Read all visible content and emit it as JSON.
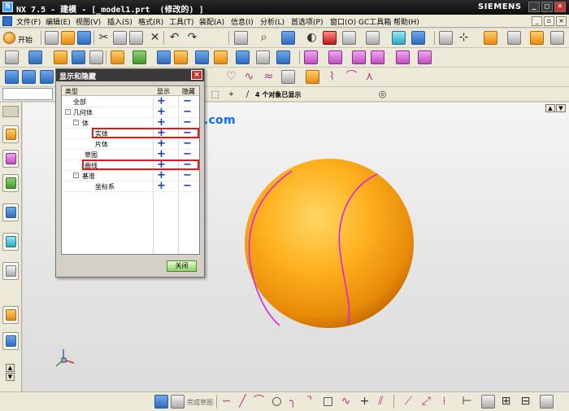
{
  "window": {
    "title": "NX 7.5 - 建模 - [_model1.prt  (修改的) ]",
    "brand": "SIEMENS",
    "controls": [
      "_",
      "□",
      "×"
    ]
  },
  "menu": {
    "items": [
      "文件(F)",
      "编辑(E)",
      "视图(V)",
      "插入(S)",
      "格式(R)",
      "工具(T)",
      "装配(A)",
      "信息(I)",
      "分析(L)",
      "首选项(P)",
      "窗口(O)",
      "GC工具箱",
      "帮助(H)"
    ]
  },
  "toolbar": {
    "start_label": "开始"
  },
  "selection_bar": {
    "status": "4 个对象已显示"
  },
  "watermark": "www.rjzxw.com",
  "dialog": {
    "title": "显示和隐藏",
    "close_glyph": "×",
    "columns": {
      "type": "类型",
      "show": "显示",
      "hide": "隐藏"
    },
    "rows": [
      {
        "label": "全部",
        "level": 0,
        "expander": "",
        "highlighted": false
      },
      {
        "label": "几何体",
        "level": 0,
        "expander": "-",
        "highlighted": false
      },
      {
        "label": "体",
        "level": 1,
        "expander": "-",
        "highlighted": false
      },
      {
        "label": "实体",
        "level": 2,
        "expander": "",
        "highlighted": true
      },
      {
        "label": "片体",
        "level": 2,
        "expander": "",
        "highlighted": false
      },
      {
        "label": "草图",
        "level": 1,
        "expander": "",
        "highlighted": false
      },
      {
        "label": "曲线",
        "level": 1,
        "expander": "",
        "highlighted": true
      },
      {
        "label": "基准",
        "level": 1,
        "expander": "-",
        "highlighted": false
      },
      {
        "label": "坐标系",
        "level": 2,
        "expander": "",
        "highlighted": false
      }
    ],
    "show_glyph": "+",
    "hide_glyph": "−",
    "close_button": "关闭"
  },
  "sketch_toolbar": {
    "finish_label": "完成草图"
  },
  "colors": {
    "sphere_light": "#ffc53a",
    "sphere_dark": "#c96a00",
    "seam_curve": "#e020e0",
    "highlight_box": "#e01a1a",
    "watermark": "#0b6cff"
  }
}
